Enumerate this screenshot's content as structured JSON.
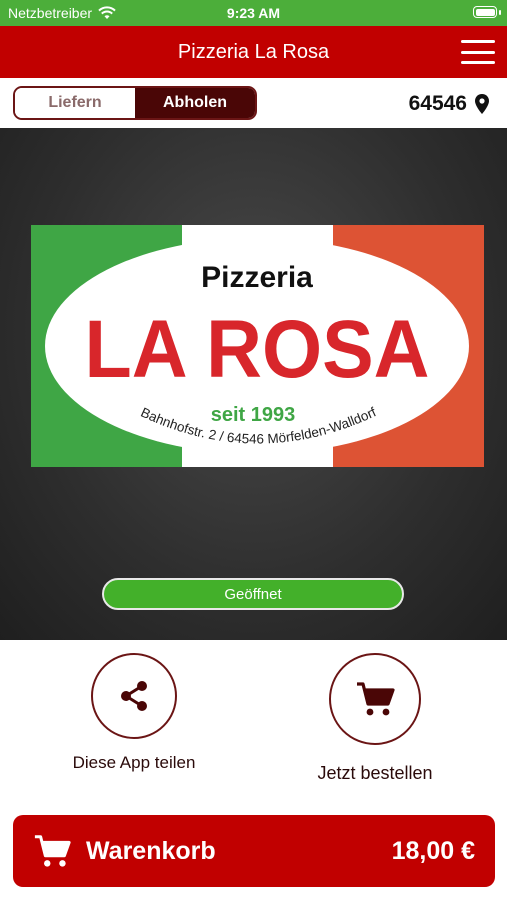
{
  "status": {
    "carrier": "Netzbetreiber",
    "time": "9:23 AM"
  },
  "header": {
    "title": "Pizzeria La Rosa"
  },
  "mode": {
    "deliver_label": "Liefern",
    "pickup_label": "Abholen",
    "selected": "Abholen"
  },
  "location": {
    "zip": "64546"
  },
  "logo": {
    "line1": "Pizzeria",
    "name": "LA ROSA",
    "since": "seit 1993",
    "address": "Bahnhofstr. 2 / 64546 Mörfelden-Walldorf"
  },
  "open_status": "Geöffnet",
  "actions": {
    "share_label": "Diese App teilen",
    "order_label": "Jetzt bestellen"
  },
  "cart": {
    "label": "Warenkorb",
    "total": "18,00 €"
  },
  "colors": {
    "brand_red": "#c10000",
    "dark_red": "#4a0606",
    "status_green": "#4cae3a",
    "open_green": "#43b02a"
  }
}
